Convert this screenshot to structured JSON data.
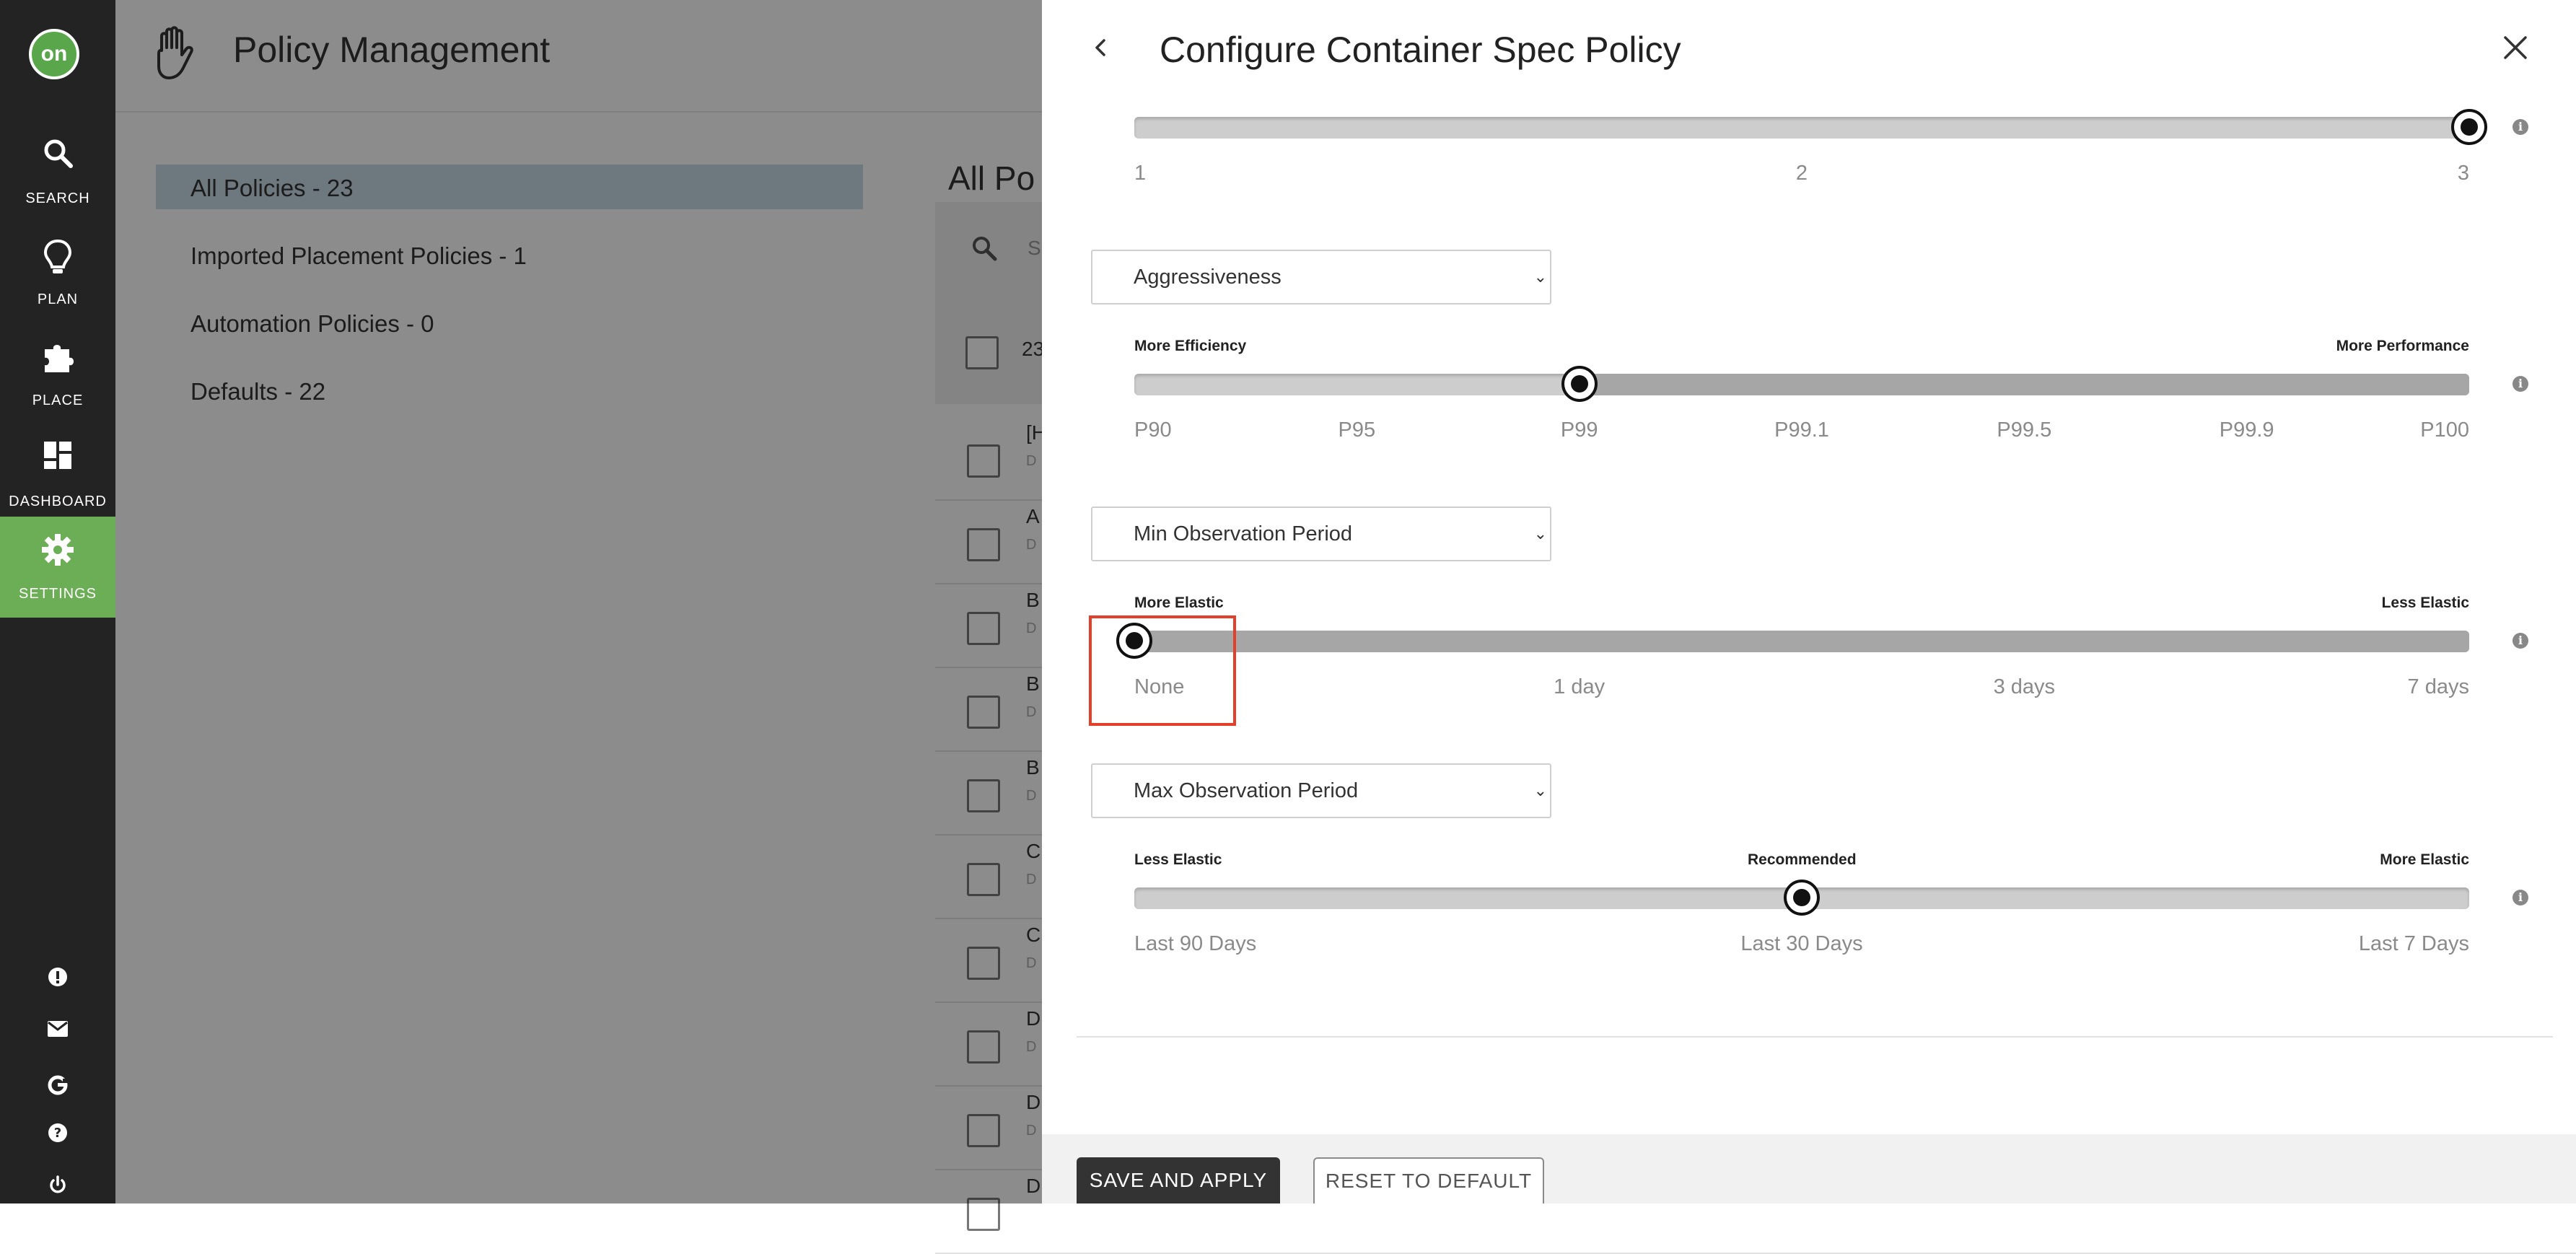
{
  "nav": {
    "logo": "on",
    "items": [
      {
        "label": "SEARCH",
        "icon": "search-icon"
      },
      {
        "label": "PLAN",
        "icon": "lightbulb-icon"
      },
      {
        "label": "PLACE",
        "icon": "puzzle-icon"
      },
      {
        "label": "DASHBOARD",
        "icon": "dashboard-icon"
      },
      {
        "label": "SETTINGS",
        "icon": "gear-icon",
        "active": true
      }
    ],
    "bottom_icons": [
      "alert-icon",
      "mail-icon",
      "google-icon",
      "help-icon",
      "power-icon"
    ],
    "active_color": "#6cae56"
  },
  "page": {
    "title": "Policy Management",
    "left_items": [
      "All Policies - 23",
      "Imported Placement Policies - 1",
      "Automation Policies - 0",
      "Defaults - 22"
    ],
    "list_title": "All Po",
    "search_placeholder": "S",
    "count": "23",
    "rows": [
      {
        "letter": "[H",
        "sub": "D"
      },
      {
        "letter": "A",
        "sub": "D"
      },
      {
        "letter": "B",
        "sub": "D"
      },
      {
        "letter": "B",
        "sub": "D"
      },
      {
        "letter": "B",
        "sub": "D"
      },
      {
        "letter": "C",
        "sub": "D"
      },
      {
        "letter": "C",
        "sub": "D"
      },
      {
        "letter": "D",
        "sub": "D"
      },
      {
        "letter": "D",
        "sub": "D"
      },
      {
        "letter": "D",
        "sub": ""
      }
    ]
  },
  "drawer": {
    "title": "Configure Container Spec Policy",
    "sliders": [
      {
        "select": "",
        "left_label": "",
        "mid_label": "",
        "right_label": "",
        "ticks": [
          "1",
          "2",
          "3"
        ],
        "value": "3",
        "fill": "none"
      },
      {
        "select": "Aggressiveness",
        "left_label": "More Efficiency",
        "mid_label": "",
        "right_label": "More Performance",
        "ticks": [
          "P90",
          "P95",
          "P99",
          "P99.1",
          "P99.5",
          "P99.9",
          "P100"
        ],
        "value": "P99",
        "fill": "right"
      },
      {
        "select": "Min Observation Period",
        "left_label": "More Elastic",
        "mid_label": "",
        "right_label": "Less Elastic",
        "ticks": [
          "None",
          "1 day",
          "3 days",
          "7 days"
        ],
        "value": "None",
        "fill": "right"
      },
      {
        "select": "Max Observation Period",
        "left_label": "Less Elastic",
        "mid_label": "Recommended",
        "right_label": "More Elastic",
        "ticks": [
          "Last 90 Days",
          "Last 30 Days",
          "Last 7 Days"
        ],
        "value": "Last 30 Days",
        "fill": "none"
      }
    ],
    "save_label": "SAVE AND APPLY",
    "reset_label": "RESET TO DEFAULT",
    "highlight_color": "#e2402b"
  }
}
